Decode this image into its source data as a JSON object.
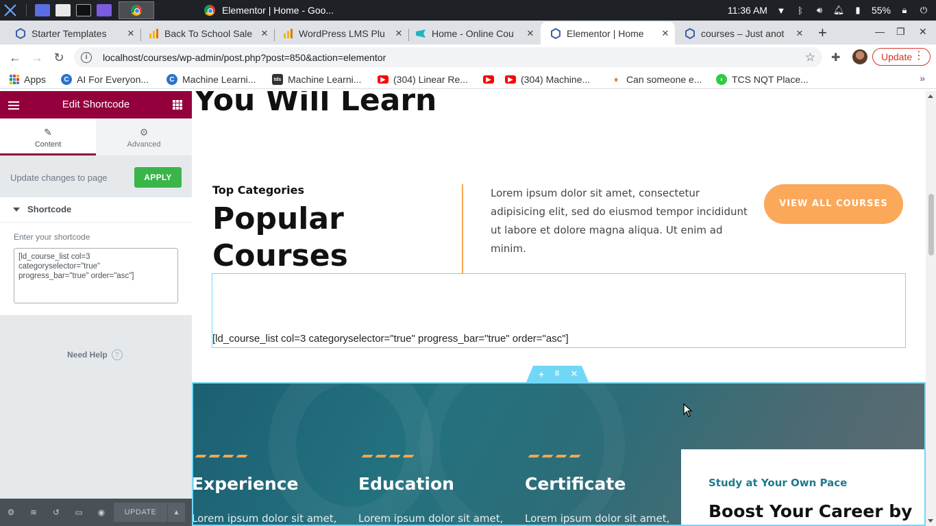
{
  "os": {
    "window_title": "Elementor | Home - Goo...",
    "clock": "11:36 AM",
    "battery": "55%"
  },
  "browser": {
    "tabs": [
      {
        "label": "Starter Templates",
        "favicon": "starter-icon"
      },
      {
        "label": "Back To School Sale",
        "favicon": "analytics-icon"
      },
      {
        "label": "WordPress LMS Plu",
        "favicon": "analytics-icon"
      },
      {
        "label": "Home - Online Cou",
        "favicon": "site-icon"
      },
      {
        "label": "Elementor | Home",
        "favicon": "wordpress-hex-icon"
      },
      {
        "label": "courses – Just anot",
        "favicon": "wordpress-hex-icon"
      }
    ],
    "url": "localhost/courses/wp-admin/post.php?post=850&action=elementor",
    "update_label": "Update",
    "bookmarks": [
      {
        "label": "Apps",
        "icon": "apps-grid-icon",
        "color": "#4285f4"
      },
      {
        "label": "AI For Everyon...",
        "icon": "coursera-icon",
        "color": "#2a73cc"
      },
      {
        "label": "Machine Learni...",
        "icon": "coursera-icon",
        "color": "#2a73cc"
      },
      {
        "label": "Machine Learni...",
        "icon": "tds-icon",
        "color": "#333333"
      },
      {
        "label": "(304) Linear Re...",
        "icon": "youtube-icon",
        "color": "#ff0000"
      },
      {
        "label": "(304) Machine...",
        "icon": "youtube-icon",
        "color": "#ff0000"
      },
      {
        "label": "Can someone e...",
        "icon": "quora-icon",
        "color": "#e67e22"
      },
      {
        "label": "TCS NQT Place...",
        "icon": "leaf-icon",
        "color": "#2ecc40"
      }
    ]
  },
  "panel": {
    "title": "Edit Shortcode",
    "tab_content": "Content",
    "tab_advanced": "Advanced",
    "apply_text": "Update changes to page",
    "apply_button": "APPLY",
    "section_title": "Shortcode",
    "field_label": "Enter your shortcode",
    "shortcode_value": "[ld_course_list col=3\ncategoryselector=\"true\"\nprogress_bar=\"true\" order=\"asc\"]",
    "need_help": "Need Help",
    "footer_update": "UPDATE",
    "accent": "#93003c"
  },
  "page": {
    "heading_partial": "You Will Learn",
    "top_categories": "Top Categories",
    "popular_line1": "Popular",
    "popular_line2": "Courses",
    "intro_text": "Lorem ipsum dolor sit amet, consectetur adipisicing elit, sed do eiusmod tempor incididunt ut labore et dolore magna aliqua. Ut enim ad minim.",
    "view_all": "VIEW ALL COURSES",
    "shortcode_preview": "[ld_course_list col=3 categoryselector=\"true\" progress_bar=\"true\" order=\"asc\"]",
    "features": [
      {
        "title": "Experience",
        "text": "Lorem ipsum dolor sit amet,"
      },
      {
        "title": "Education",
        "text": "Lorem ipsum dolor sit amet,"
      },
      {
        "title": "Certificate",
        "text": "Lorem ipsum dolor sit amet,"
      }
    ],
    "card_kicker": "Study at Your Own Pace",
    "card_heading": "Boost Your Career by",
    "accent": "#fba85a",
    "teal": "#1f7a8c"
  }
}
